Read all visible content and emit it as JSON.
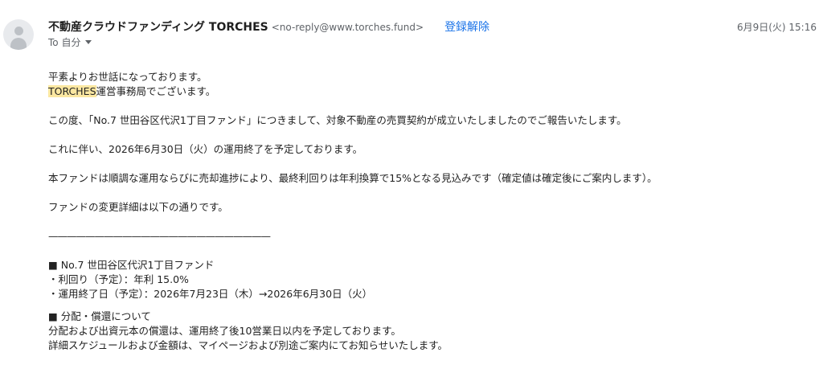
{
  "sender": {
    "name": "不動産クラウドファンディング TORCHES",
    "email": "<no-reply@www.torches.fund>"
  },
  "unsubscribe_label": "登録解除",
  "date": "6月9日(火) 15:16",
  "recipient": {
    "label": "To 自分"
  },
  "body": {
    "greeting": "平素よりお世話になっております。",
    "org_highlight": "TORCHES",
    "org_rest": "運営事務局でございます。",
    "para1": "この度、「No.7 世田谷区代沢1丁目ファンド」につきまして、対象不動産の売買契約が成立いたしましたのでご報告いたします。",
    "para2": "これに伴い、2026年6月30日（火）の運用終了を予定しております。",
    "para3": "本ファンドは順調な運用ならびに売却進捗により、最終利回りは年利換算で15%となる見込みです（確定値は確定後にご案内します）。",
    "para4": "ファンドの変更詳細は以下の通りです。",
    "divider": "————————————————————————",
    "fund_heading": "■ No.7 世田谷区代沢1丁目ファンド",
    "fund_yield": "・利回り（予定）：年利 15.0%",
    "fund_end": "・運用終了日（予定）：2026年7月23日（木）→2026年6月30日（火）",
    "dist_heading": "■ 分配・償還について",
    "dist_line1": "分配および出資元本の償還は、運用終了後10営業日以内を予定しております。",
    "dist_line2": "詳細スケジュールおよび金額は、マイページおよび別途ご案内にてお知らせいたします。"
  }
}
